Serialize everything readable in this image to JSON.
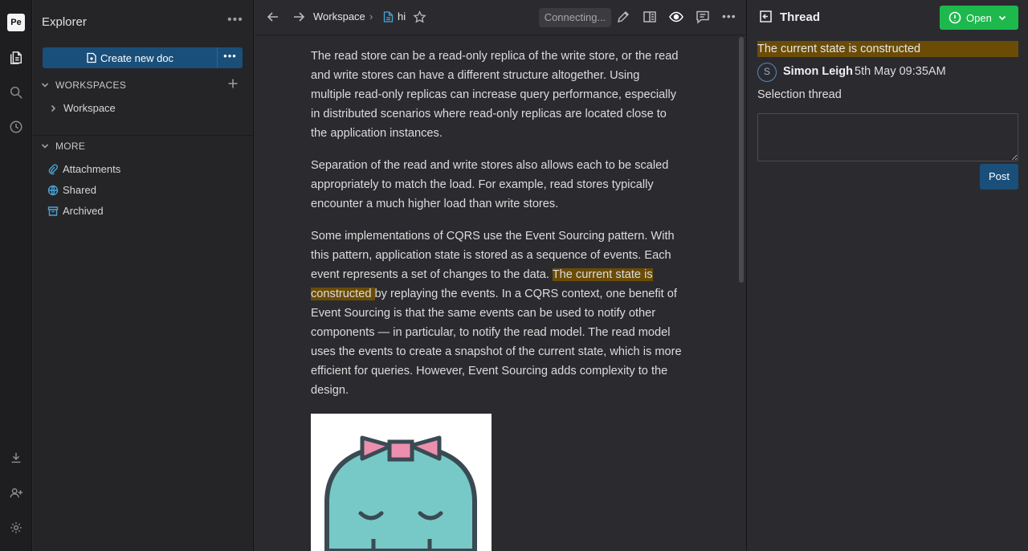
{
  "app": {
    "logo_text": "Pe"
  },
  "rail": {
    "items": [
      "documents-icon",
      "search-icon",
      "history-icon"
    ],
    "bottom_items": [
      "download-icon",
      "invite-people-icon",
      "settings-icon"
    ]
  },
  "explorer": {
    "title": "Explorer",
    "create_label": "Create new doc",
    "workspaces_header": "WORKSPACES",
    "workspace_item": "Workspace",
    "more_header": "MORE",
    "more_items": [
      {
        "label": "Attachments",
        "icon": "paperclip-icon"
      },
      {
        "label": "Shared",
        "icon": "globe-icon"
      },
      {
        "label": "Archived",
        "icon": "archive-icon"
      }
    ]
  },
  "topbar": {
    "breadcrumb_workspace": "Workspace",
    "breadcrumb_separator": "›",
    "doc_name": "hi",
    "status": "Connecting..."
  },
  "document": {
    "p1": "The read store can be a read-only replica of the write store, or the read and write stores can have a different structure altogether. Using multiple read-only replicas can increase query performance, especially in distributed scenarios where read-only replicas are located close to the application instances.",
    "p2": "Separation of the read and write stores also allows each to be scaled appropriately to match the load. For example, read stores typically encounter a much higher load than write stores.",
    "p3_before": "Some implementations of CQRS use the Event Sourcing pattern. With this pattern, application state is stored as a sequence of events. Each event represents a set of changes to the data. ",
    "p3_highlight": "The current state is constructed ",
    "p3_after": "by replaying the events. In a CQRS context, one benefit of Event Sourcing is that the same events can be used to notify other components — in particular, to notify the read model. The read model uses the events to create a snapshot of the current state, which is more efficient for queries. However, Event Sourcing adds complexity to the design."
  },
  "thread": {
    "title": "Thread",
    "status_label": "Open",
    "quote": "The current state is constructed",
    "avatar_initial": "S",
    "author": "Simon Leigh",
    "timestamp": "5th May 09:35AM",
    "message": "Selection thread",
    "reply_value": "",
    "post_label": "Post"
  },
  "colors": {
    "accent": "#1a4f7a",
    "open_green": "#1db94d",
    "highlight": "#6b4c07",
    "link_icon": "#4aa3d6"
  }
}
